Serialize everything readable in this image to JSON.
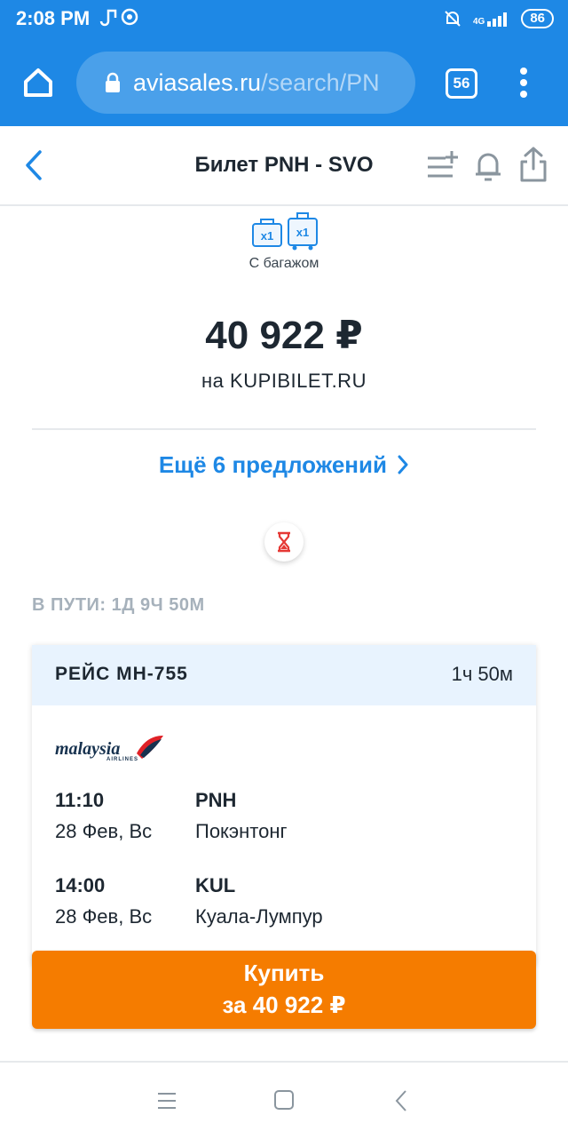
{
  "status_bar": {
    "time": "2:08 PM",
    "network": "4G",
    "battery": "86"
  },
  "browser": {
    "url_host": "aviasales.ru",
    "url_path": "/search/PN",
    "tab_count": "56"
  },
  "header": {
    "title": "Билет PNH - SVO"
  },
  "baggage": {
    "badge_1": "x1",
    "badge_2": "x1",
    "label": "С багажом"
  },
  "offer": {
    "price": "40 922 ₽",
    "seller": "на KUPIBILET.RU"
  },
  "more_offers": {
    "label": "Ещё 6 предложений"
  },
  "travel_time": {
    "label": "В ПУТИ: 1Д 9Ч 50М"
  },
  "flight": {
    "number": "РЕЙС MH-755",
    "duration": "1ч 50м",
    "airline_logo_text": "malaysia",
    "airline_logo_sub": "AIRLINES",
    "departure": {
      "time": "11:10",
      "date": "28 Фев, Вс",
      "code": "PNH",
      "city": "Покэнтонг"
    },
    "arrival": {
      "time": "14:00",
      "date": "28 Фев, Вс",
      "code": "KUL",
      "city": "Куала-Лумпур"
    }
  },
  "buy_button": {
    "line1": "Купить",
    "line2": "за 40 922 ₽"
  },
  "colors": {
    "brand_blue": "#1e88e5",
    "buy_orange": "#f57c00",
    "header_tint": "#e8f3fe"
  }
}
